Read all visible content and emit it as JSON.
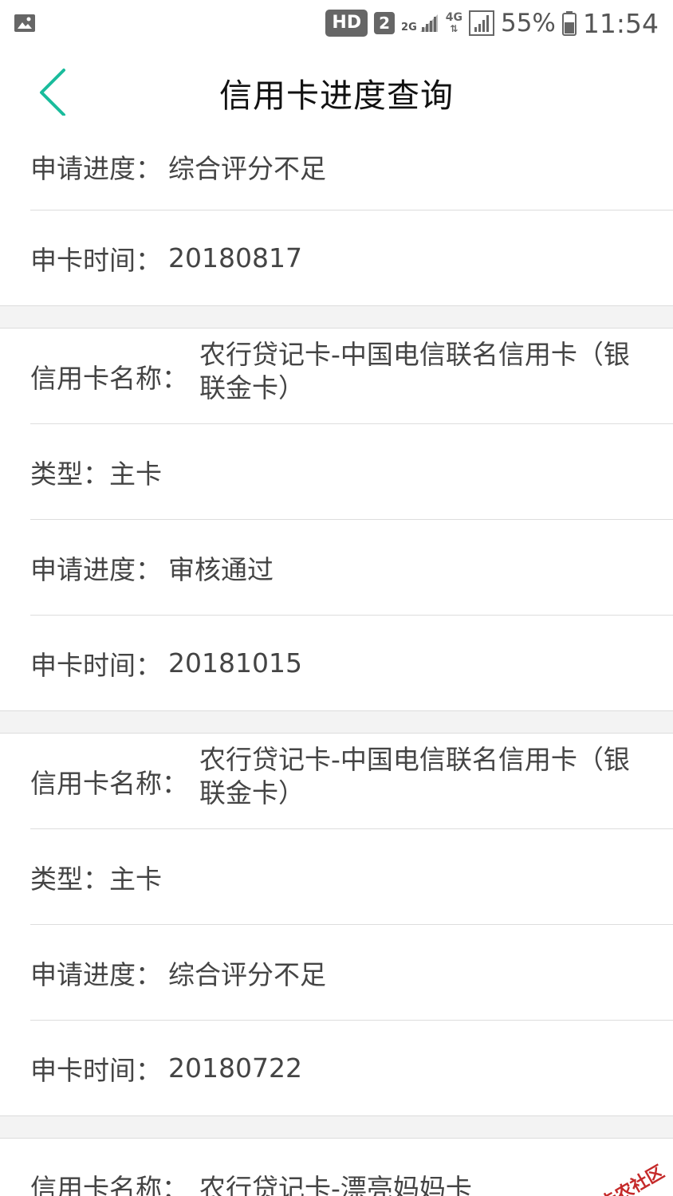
{
  "status_bar": {
    "hd": "HD",
    "sim": "2",
    "net_2g": "2G",
    "net_4g": "4G",
    "battery": "55%",
    "time": "11:54",
    "icons": [
      "image-icon",
      "signal-icon",
      "battery-icon"
    ]
  },
  "header": {
    "title": "信用卡进度查询",
    "back_icon": "chevron-left-icon",
    "accent_color": "#1ABC9C"
  },
  "records": [
    {
      "progress_label": "申请进度：",
      "progress_value": "综合评分不足",
      "time_label": "申卡时间：",
      "time_value": "20180817"
    },
    {
      "name_label": "信用卡名称：",
      "name_value": "农行贷记卡-中国电信联名信用卡（银联金卡）",
      "type_label": "类型：",
      "type_value": "主卡",
      "progress_label": "申请进度：",
      "progress_value": "审核通过",
      "time_label": "申卡时间：",
      "time_value": "20181015"
    },
    {
      "name_label": "信用卡名称：",
      "name_value": "农行贷记卡-中国电信联名信用卡（银联金卡）",
      "type_label": "类型：",
      "type_value": "主卡",
      "progress_label": "申请进度：",
      "progress_value": "综合评分不足",
      "time_label": "申卡时间：",
      "time_value": "20180722"
    },
    {
      "name_label": "信用卡名称：",
      "name_value": "农行贷记卡-漂亮妈妈卡"
    }
  ],
  "watermark": {
    "text": "卡农社区"
  }
}
